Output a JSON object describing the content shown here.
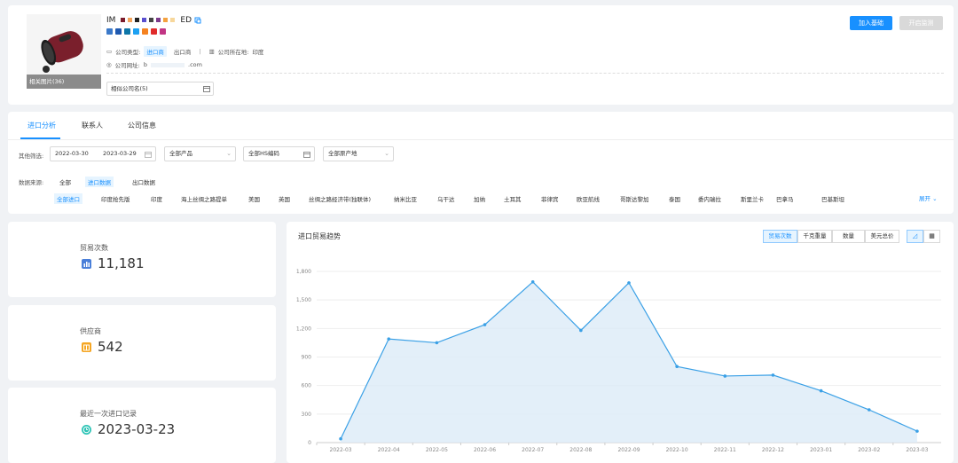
{
  "company": {
    "name_prefix": "IM",
    "name_suffix": "ED",
    "swatch_colors": [
      "#7b1c2c",
      "#f2a35b",
      "#222222",
      "#5a4fcf",
      "#444444",
      "#7c3a8c",
      "#f4a13e",
      "#f7d79b"
    ],
    "image_caption": "相关图片(36)",
    "type_label": "公司类型:",
    "type_import": "进口商",
    "type_export": "出口商",
    "separator": "|",
    "country_label": "公司所在地:",
    "country_value": "印度",
    "website_label": "公司网址:",
    "website_prefix": "b",
    "website_suffix": ".com",
    "similar_placeholder": "相似公司名(5)",
    "add_button": "加入基础",
    "monitor_button": "开启监测"
  },
  "social": [
    "#3b79c9",
    "#1f59b0",
    "#0e76a8",
    "#1da1f2",
    "#f58220",
    "#e02b2b",
    "#c13584"
  ],
  "tabs": {
    "import_analysis": "进口分析",
    "contacts": "联系人",
    "company_info": "公司信息"
  },
  "filters": {
    "other_label": "其他筛选:",
    "date_start": "2022-03-30",
    "date_end": "2023-03-29",
    "product": "全部产品",
    "hs_code": "全部HS编码",
    "origin": "全部原产地",
    "source_label": "数据来源:",
    "source_all": "全部",
    "source_import": "进口数据",
    "source_export": "出口数据",
    "expand": "展开"
  },
  "countries": [
    "全部进口",
    "印度抢先版",
    "印度",
    "海上丝绸之路提单",
    "美国",
    "英国",
    "丝绸之路经济带(独联体)",
    "纳米比亚",
    "乌干达",
    "加纳",
    "土耳其",
    "菲律宾",
    "欧亚航线",
    "哥斯达黎加",
    "泰国",
    "委内瑞拉",
    "斯里兰卡",
    "巴拿马",
    "巴基斯坦"
  ],
  "stats": {
    "trade_count_label": "贸易次数",
    "trade_count_value": "11,181",
    "suppliers_label": "供应商",
    "suppliers_value": "542",
    "last_import_label": "最近一次进口记录",
    "last_import_value": "2023-03-23"
  },
  "chart_panel": {
    "title": "进口贸易趋势",
    "segments": [
      "贸易次数",
      "千克重量",
      "数量",
      "美元总价"
    ]
  },
  "chart_data": {
    "type": "area",
    "categories": [
      "2022-03",
      "2022-04",
      "2022-05",
      "2022-06",
      "2022-07",
      "2022-08",
      "2022-09",
      "2022-10",
      "2022-11",
      "2022-12",
      "2023-01",
      "2023-02",
      "2023-03"
    ],
    "values": [
      40,
      1090,
      1050,
      1240,
      1690,
      1180,
      1680,
      800,
      700,
      710,
      545,
      345,
      120
    ],
    "ylim": [
      0,
      1800
    ],
    "yticks": [
      0,
      300,
      600,
      900,
      1200,
      1500,
      1800
    ],
    "ytick_labels": [
      "0",
      "300",
      "600",
      "900",
      "1,200",
      "1,500",
      "1,800"
    ],
    "color": "#3aa0e6",
    "fill": "#dcebf8",
    "grid": true
  }
}
